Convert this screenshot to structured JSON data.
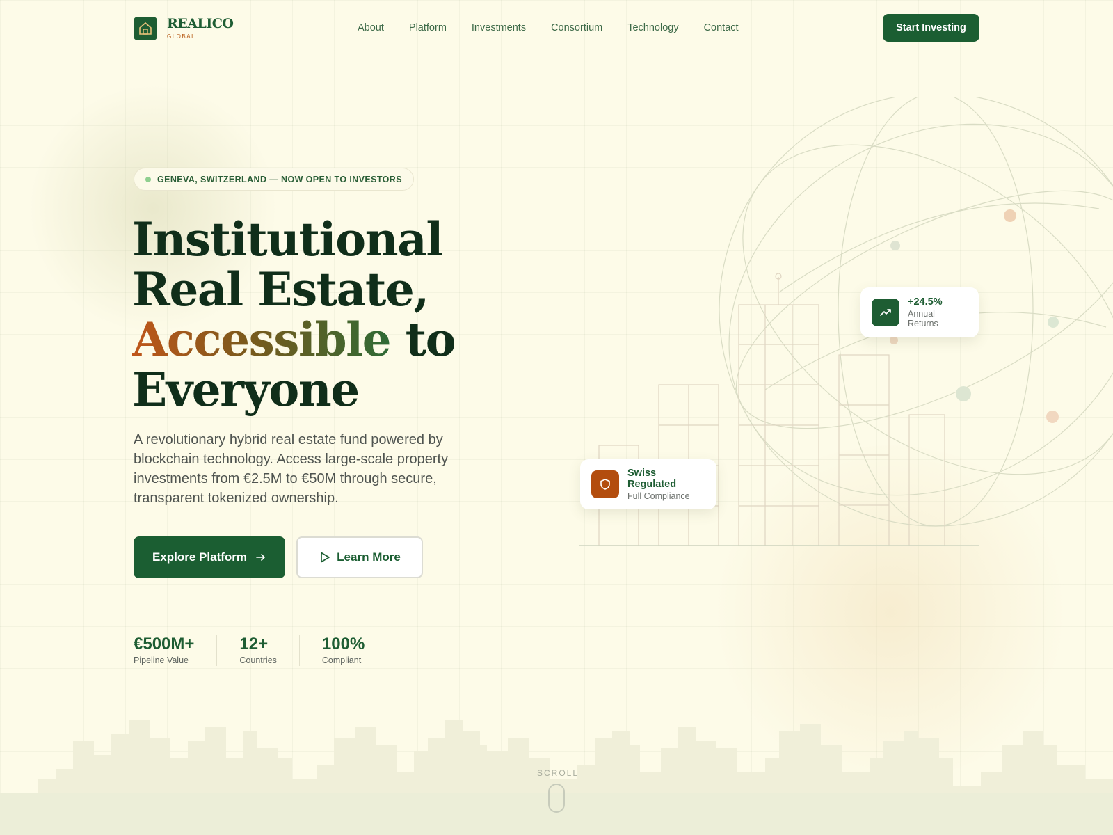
{
  "brand": {
    "name": "REALICO",
    "tagline": "GLOBAL",
    "icon": "house-icon",
    "primary_color": "#1b5e32",
    "accent_color": "#b55610",
    "background_color": "#fdfbe8"
  },
  "nav": {
    "items": [
      {
        "label": "About"
      },
      {
        "label": "Platform"
      },
      {
        "label": "Investments"
      },
      {
        "label": "Consortium"
      },
      {
        "label": "Technology"
      },
      {
        "label": "Contact"
      }
    ],
    "cta_label": "Start Investing"
  },
  "hero": {
    "badge": "GENEVA, SWITZERLAND — NOW OPEN TO INVESTORS",
    "headline": {
      "line1": "Institutional",
      "line2": "Real Estate,",
      "accent": "Accessible",
      "line3_rest": " to",
      "line4": "Everyone"
    },
    "description": "A revolutionary hybrid real estate fund powered by blockchain technology. Access large-scale property investments from €2.5M to €50M through secure, transparent tokenized ownership.",
    "primary_button": "Explore Platform",
    "primary_button_icon": "arrow-right-icon",
    "secondary_button": "Learn More",
    "secondary_button_icon": "play-icon"
  },
  "stats": [
    {
      "value": "€500M+",
      "label": "Pipeline Value"
    },
    {
      "value": "12+",
      "label": "Countries"
    },
    {
      "value": "100%",
      "label": "Compliant"
    }
  ],
  "cards": {
    "returns": {
      "title": "+24.5%",
      "subtitle": "Annual Returns",
      "icon": "trending-up-icon"
    },
    "swiss": {
      "title": "Swiss Regulated",
      "subtitle": "Full Compliance",
      "icon": "shield-icon"
    }
  },
  "scroll": {
    "label": "SCROLL"
  }
}
